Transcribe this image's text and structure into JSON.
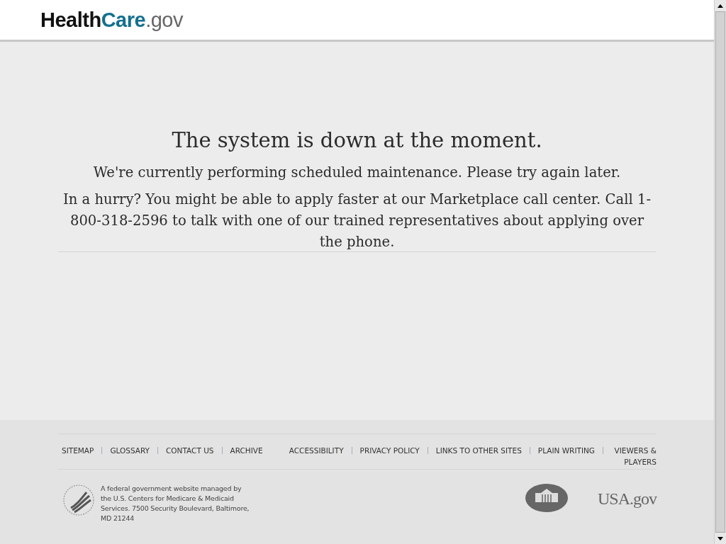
{
  "header": {
    "logo": {
      "part_1": "Health",
      "part_2": "Care",
      "part_3": ".gov"
    }
  },
  "message": {
    "title": "The system is down at the moment.",
    "paragraphs": [
      "We're currently performing scheduled maintenance. Please try again later.",
      "In a hurry? You might be able to apply faster at our Marketplace call center. Call 1-800-318-2596 to talk with one of our trained representatives about applying over the phone."
    ]
  },
  "footer": {
    "links_left": [
      "SITEMAP",
      "GLOSSARY",
      "CONTACT US",
      "ARCHIVE"
    ],
    "links_right": [
      "ACCESSIBILITY",
      "PRIVACY POLICY",
      "LINKS TO OTHER SITES",
      "PLAIN WRITING",
      "VIEWERS & PLAYERS"
    ],
    "agency_text": "A federal government website managed by the U.S. Centers for Medicare & Medicaid Services. 7500 Security Boulevard, Baltimore, MD 21244",
    "usa_logo": "USA.gov"
  }
}
